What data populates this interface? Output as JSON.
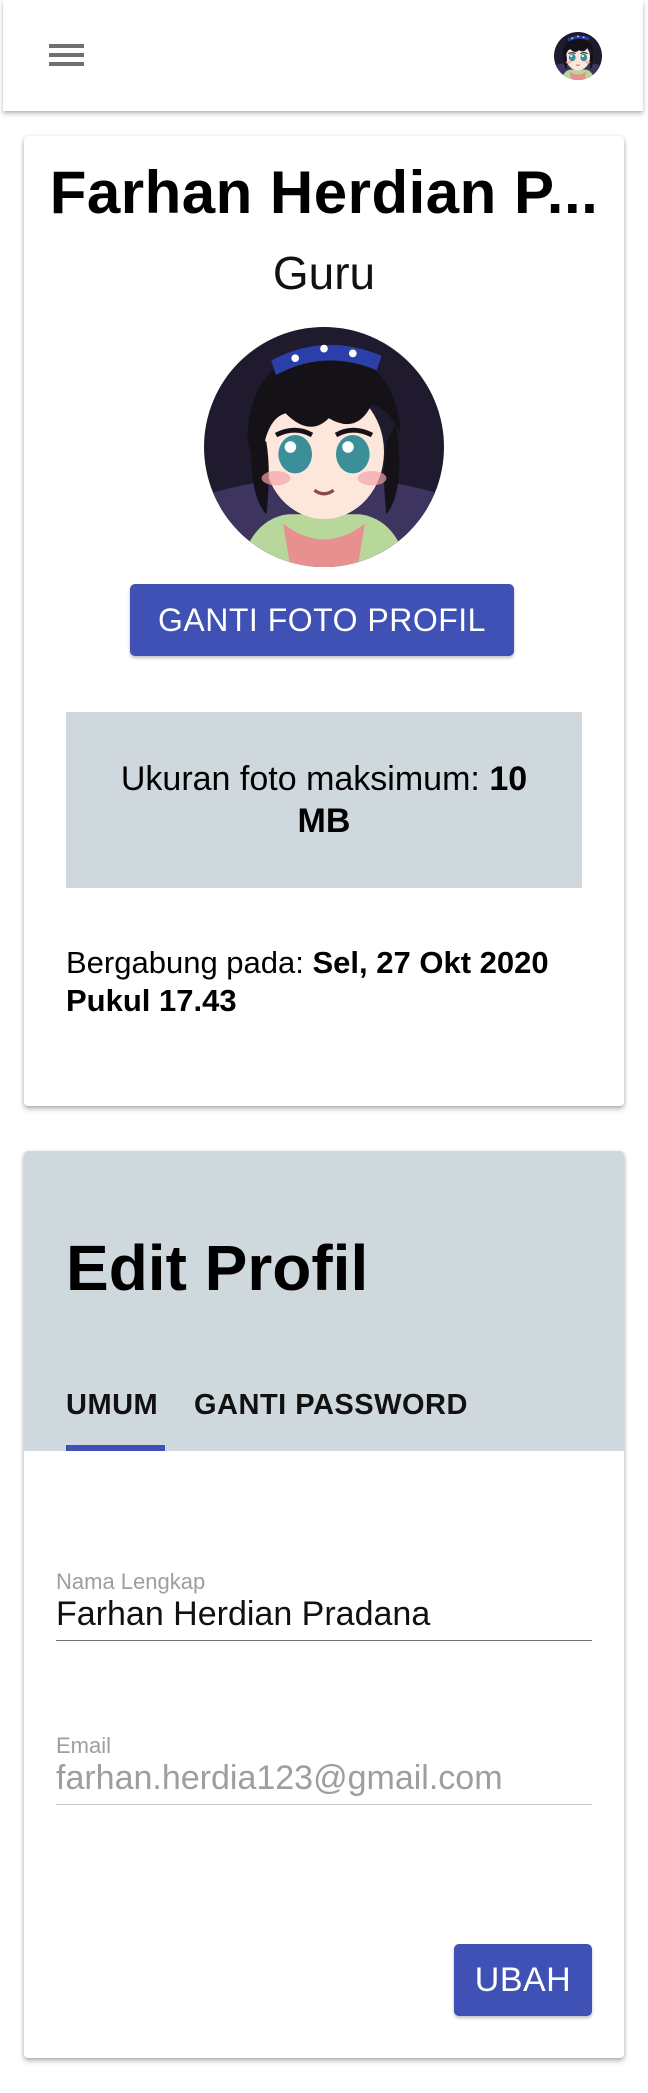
{
  "appbar": {
    "menu_icon": "hamburger-menu-icon",
    "avatar_icon": "user-avatar"
  },
  "profile": {
    "name": "Farhan Herdian P...",
    "role": "Guru",
    "change_photo_label": "GANTI FOTO PROFIL",
    "max_size_prefix": "Ukuran foto maksimum: ",
    "max_size_value": "10 MB",
    "joined_prefix": "Bergabung pada: ",
    "joined_value": "Sel, 27 Okt 2020 Pukul 17.43"
  },
  "edit": {
    "title": "Edit Profil",
    "tabs": [
      {
        "label": "UMUM",
        "active": true
      },
      {
        "label": "GANTI PASSWORD",
        "active": false
      }
    ],
    "fields": {
      "name": {
        "label": "Nama Lengkap",
        "value": "Farhan Herdian Pradana"
      },
      "email": {
        "label": "Email",
        "value": "farhan.herdia123@gmail.com"
      }
    },
    "submit_label": "UBAH"
  },
  "colors": {
    "primary": "#3f51b5",
    "panel": "#cfd8dc"
  }
}
